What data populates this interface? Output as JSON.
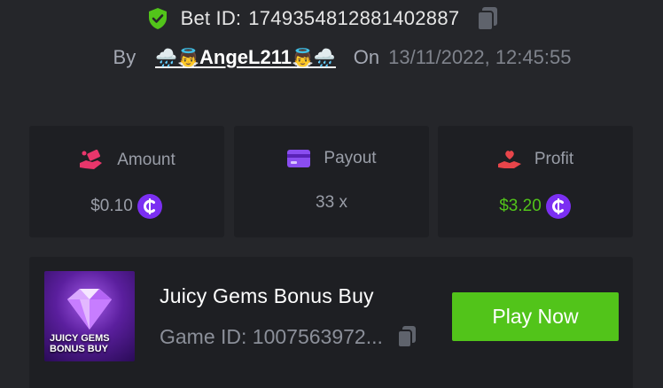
{
  "bet": {
    "label": "Bet ID:",
    "id": "1749354812881402887"
  },
  "by": {
    "by_label": "By",
    "username": "AngeL211",
    "emoji_left": "🌧️👼",
    "emoji_right": "👼🌧️",
    "on_label": "On",
    "date": "13/11/2022, 12:45:55"
  },
  "stats": {
    "amount": {
      "label": "Amount",
      "value": "$0.10"
    },
    "payout": {
      "label": "Payout",
      "value": "33 x"
    },
    "profit": {
      "label": "Profit",
      "value": "$3.20"
    }
  },
  "game": {
    "title": "Juicy Gems Bonus Buy",
    "id_text": "Game ID: 1007563972...",
    "thumb_text_line1": "JUICY GEMS",
    "thumb_text_line2": "BONUS BUY",
    "play_label": "Play Now"
  },
  "colors": {
    "background": "#25262a",
    "card": "#1e1f23",
    "green": "#52c41a",
    "coin_purple": "#7b2ff2",
    "amount_pink": "#e8366b",
    "payout_purple": "#8a4df0",
    "profit_red": "#e8454a"
  },
  "icons": {
    "shield": "shield-check-icon",
    "copy": "copy-icon",
    "amount": "hand-money-icon",
    "payout": "card-icon",
    "profit": "hand-heart-icon",
    "coin": "coin-icon"
  }
}
